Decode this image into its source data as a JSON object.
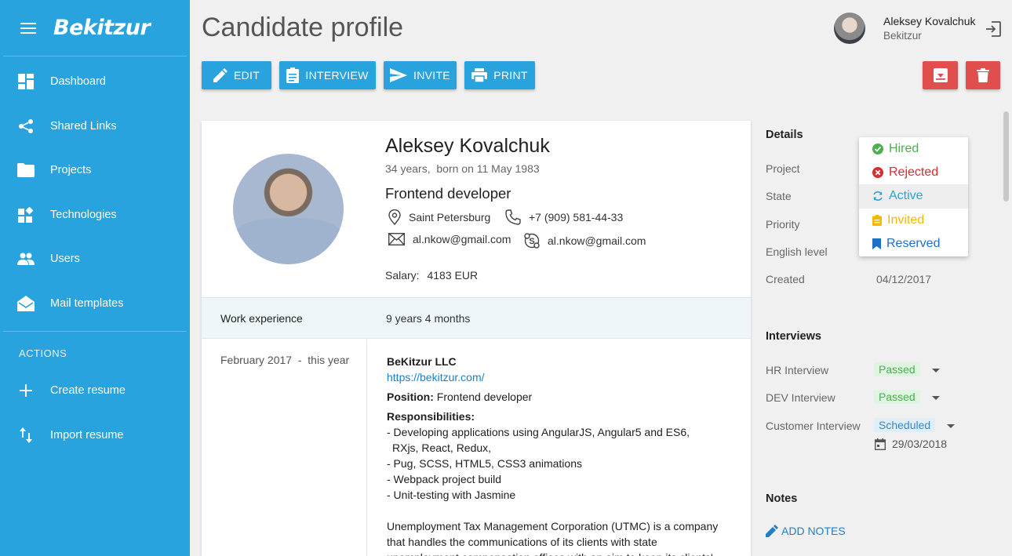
{
  "app": {
    "logo": "Bekitzur"
  },
  "sidebar": {
    "items": [
      {
        "label": "Dashboard",
        "icon": "dashboard-icon"
      },
      {
        "label": "Shared Links",
        "icon": "share-icon"
      },
      {
        "label": "Projects",
        "icon": "folder-icon"
      },
      {
        "label": "Technologies",
        "icon": "widgets-icon"
      },
      {
        "label": "Users",
        "icon": "users-icon"
      },
      {
        "label": "Mail templates",
        "icon": "mail-icon"
      }
    ],
    "section_title": "ACTIONS",
    "actions": [
      {
        "label": "Create resume",
        "icon": "plus-icon"
      },
      {
        "label": "Import resume",
        "icon": "import-icon"
      }
    ]
  },
  "header": {
    "title": "Candidate profile",
    "user_name": "Aleksey Kovalchuk",
    "user_org": "Bekitzur"
  },
  "toolbar": {
    "edit": "EDIT",
    "interview": "INTERVIEW",
    "invite": "INVITE",
    "print": "PRINT"
  },
  "candidate": {
    "name": "Aleksey Kovalchuk",
    "age": "34 years,",
    "born_label": "born on",
    "born_date": "11 May 1983",
    "role": "Frontend developer",
    "city": "Saint Petersburg",
    "phone": "+7 (909) 581-44-33",
    "email": "al.nkow@gmail.com",
    "skype": "al.nkow@gmail.com",
    "salary_label": "Salary:",
    "salary_value": "4183",
    "salary_currency": "EUR"
  },
  "work": {
    "label": "Work experience",
    "value": "9 years 4 months",
    "entry": {
      "period_from": "February 2017",
      "period_sep": "-",
      "period_to": "this year",
      "company": "BeKitzur LLC",
      "url": "https://bekitzur.com/",
      "position_label": "Position:",
      "position_value": "Frontend developer",
      "responsibilities_label": "Responsibilities:",
      "responsibilities": [
        "- Developing applications using AngularJS, Angular5 and ES6,",
        "  RXjs, React, Redux,",
        "- Pug, SCSS, HTML5, CSS3 animations",
        "- Webpack project build",
        "- Unit-testing with Jasmine"
      ],
      "description": [
        "Unemployment Tax Management Corporation (UTMC) is a company",
        "that handles the communications of its clients with state",
        "unemployment compensation offices with an aim to keep its clients'"
      ]
    }
  },
  "details": {
    "title": "Details",
    "fields": [
      {
        "label": "Project"
      },
      {
        "label": "State"
      },
      {
        "label": "Priority"
      },
      {
        "label": "English level"
      },
      {
        "label": "Created",
        "value": "04/12/2017"
      }
    ]
  },
  "state_dropdown": {
    "options": [
      {
        "label": "Hired",
        "color": "#4caf50",
        "icon": "check-circle-icon"
      },
      {
        "label": "Rejected",
        "color": "#d32f2f",
        "icon": "cancel-circle-icon"
      },
      {
        "label": "Active",
        "color": "#29a3de",
        "icon": "refresh-icon",
        "selected": true
      },
      {
        "label": "Invited",
        "color": "#f5b800",
        "icon": "clipboard-icon"
      },
      {
        "label": "Reserved",
        "color": "#1e6fc7",
        "icon": "bookmark-icon"
      }
    ]
  },
  "interviews": {
    "title": "Interviews",
    "items": [
      {
        "label": "HR Interview",
        "status": "Passed"
      },
      {
        "label": "DEV Interview",
        "status": "Passed"
      },
      {
        "label": "Customer Interview",
        "status": "Scheduled",
        "date": "29/03/2018"
      }
    ]
  },
  "notes": {
    "title": "Notes",
    "add_label": "ADD NOTES"
  },
  "colors": {
    "sidebar": "#29a3de",
    "primary_button": "#29a3de",
    "danger_button": "#e04e4e",
    "link": "#1e7fc7"
  }
}
